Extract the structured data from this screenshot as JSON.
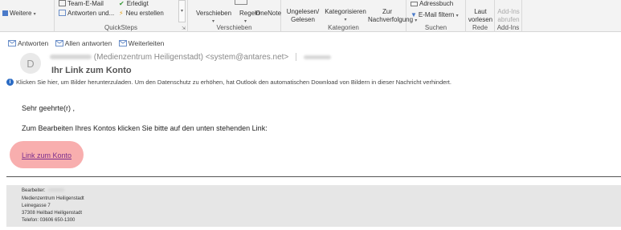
{
  "ribbon": {
    "weitere": "Weitere",
    "quicksteps": {
      "items": [
        "Team-E-Mail",
        "Antworten und...",
        "Erledigt",
        "Neu erstellen"
      ],
      "label": "QuickSteps"
    },
    "verschieben": {
      "items": [
        "Verschieben",
        "Regeln",
        "OneNote"
      ],
      "label": "Verschieben"
    },
    "kategorien": {
      "ungelesen": [
        "Ungelesen/",
        "Gelesen"
      ],
      "kategorisieren": "Kategorisieren",
      "zur_nachverfolgung": [
        "Zur",
        "Nachverfolgung"
      ],
      "label": "Kategorien"
    },
    "suchen": {
      "adressbuch": "Adressbuch",
      "filter": "E-Mail filtern",
      "label": "Suchen"
    },
    "rede": {
      "laut_vorlesen": [
        "Laut",
        "vorlesen"
      ],
      "label": "Rede"
    },
    "addins": {
      "abrufen": [
        "Add-Ins",
        "abrufen"
      ],
      "label": "Add-Ins"
    }
  },
  "message": {
    "actions": {
      "reply": "Antworten",
      "reply_all": "Allen antworten",
      "forward": "Weiterleiten"
    },
    "avatar_initial": "D",
    "sender_display": "(Medienzentrum Heiligenstadt) <system@antares.net>",
    "subject": "Ihr Link zum Konto",
    "infobar": "Klicken Sie hier, um Bilder herunterzuladen. Um den Datenschutz zu erhöhen, hat Outlook den automatischen Download von Bildern in dieser Nachricht verhindert.",
    "greeting": "Sehr geehrte(r) ,",
    "instruction": "Zum Bearbeiten Ihres Kontos klicken Sie bitte auf den unten stehenden Link:",
    "link_text": "Link zum Konto",
    "highlight_color": "#f7a0a0",
    "link_color": "#7b2d8e"
  },
  "footer": {
    "bearbeiter_label": "Bearbeiter:",
    "lines": [
      "Medienzentrum Heiligenstadt",
      "Leinegasse 7",
      "37308 Heilbad Heiligenstadt",
      "Telefon: 03606 650-1300"
    ]
  }
}
